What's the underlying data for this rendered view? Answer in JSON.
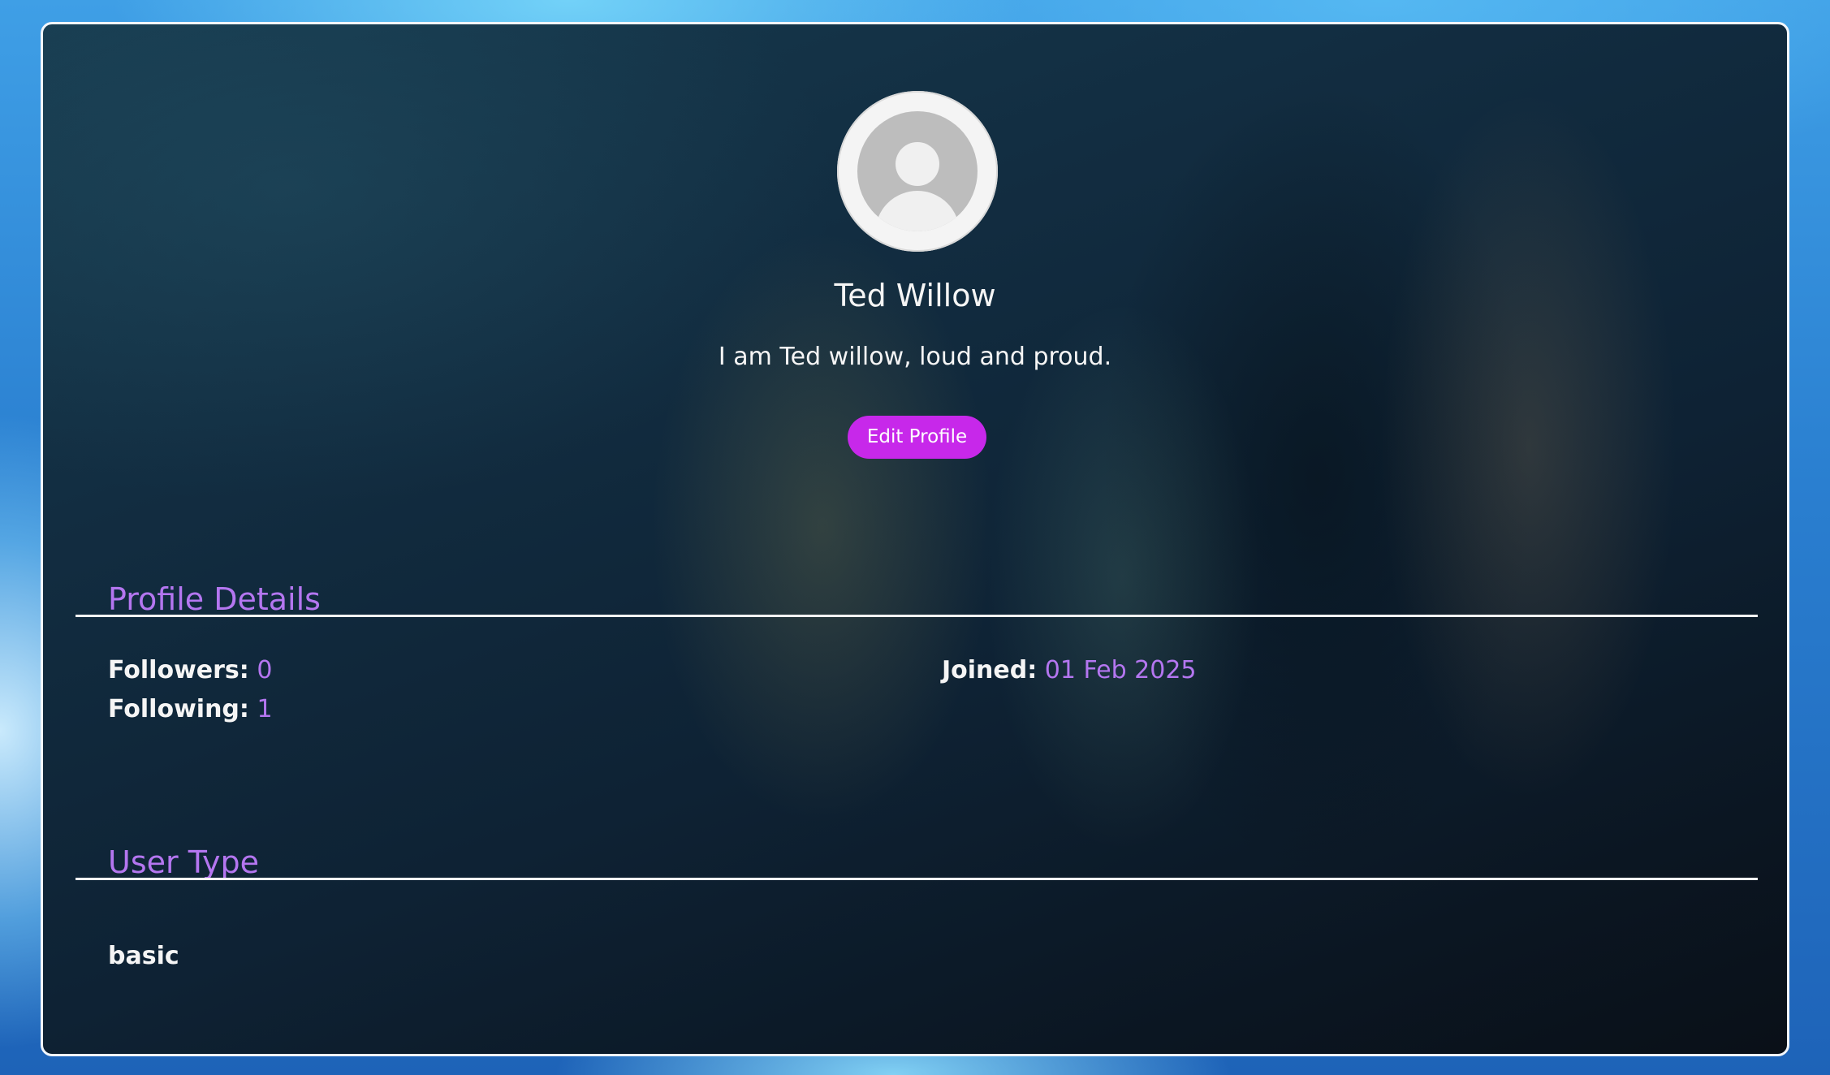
{
  "profile": {
    "name": "Ted Willow",
    "bio": "I am Ted willow, loud and proud.",
    "edit_button_label": "Edit Profile"
  },
  "profile_details": {
    "title": "Profile Details",
    "followers_label": "Followers:",
    "followers_value": "0",
    "following_label": "Following:",
    "following_value": "1",
    "joined_label": "Joined:",
    "joined_value": "01 Feb 2025"
  },
  "user_type": {
    "title": "User Type",
    "value": "basic"
  },
  "colors": {
    "accent": "#b476f0",
    "button": "#c728ea",
    "card_border": "#f2f6fb"
  },
  "icons": {
    "avatar": "default-user-avatar-icon"
  }
}
